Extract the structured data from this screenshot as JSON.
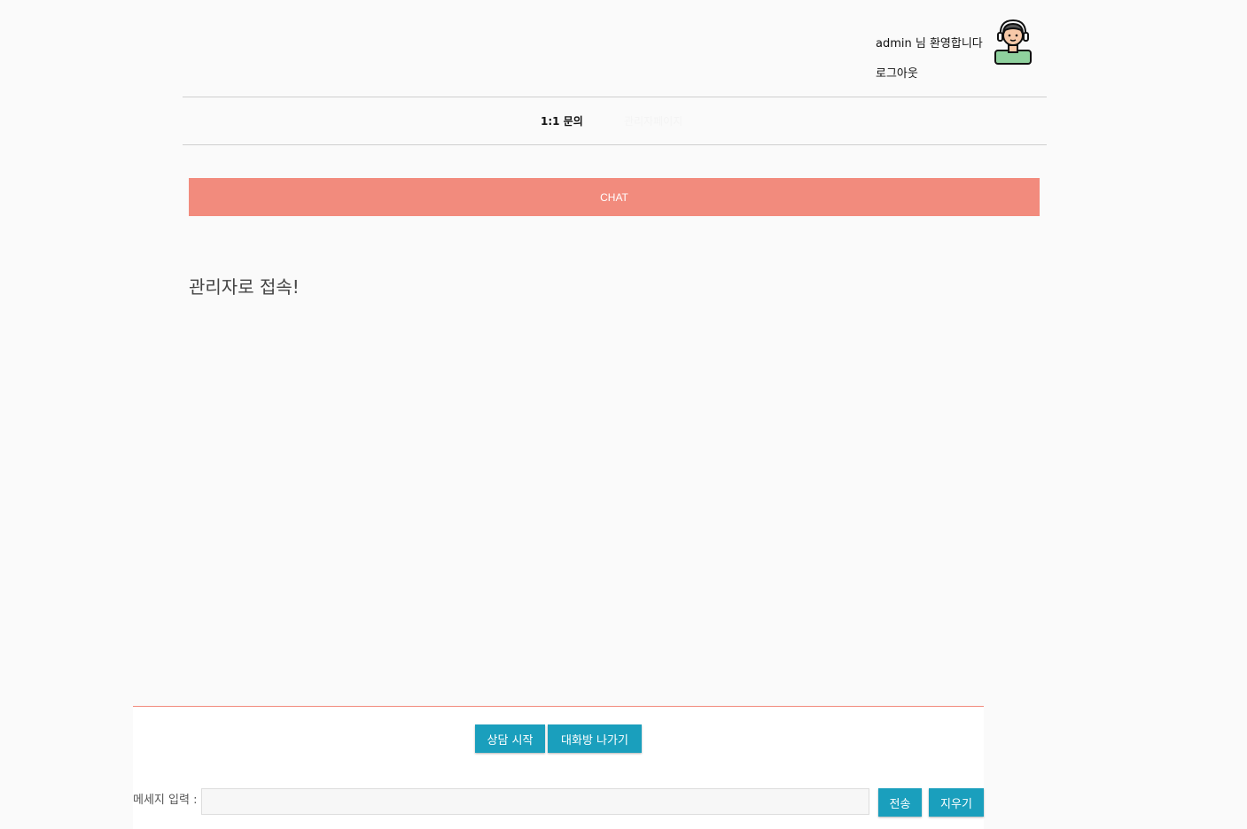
{
  "header": {
    "welcome": "admin 님 환영합니다",
    "logout": "로그아웃",
    "avatar_icon": "support-agent-icon"
  },
  "nav": {
    "tabs": [
      {
        "label": "1:1 문의"
      },
      {
        "label": "관리자페이지"
      }
    ]
  },
  "chat": {
    "bar_label": "CHAT",
    "messages": [
      "관리자로 접속!"
    ]
  },
  "footer": {
    "start_button": "상담 시작",
    "leave_button": "대화방 나가기",
    "input_label": "메세지 입력 :",
    "input_value": "",
    "send_button": "전송",
    "clear_button": "지우기"
  },
  "colors": {
    "accent": "#f28b7d",
    "button": "#1a9fbd"
  }
}
